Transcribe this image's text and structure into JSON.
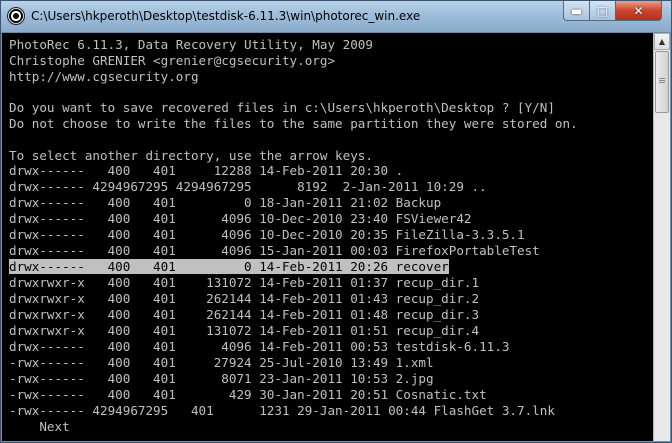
{
  "window": {
    "title": "C:\\Users\\hkperoth\\Desktop\\testdisk-6.11.3\\win\\photorec_win.exe",
    "controls": {
      "minimize": "▬",
      "maximize": "□",
      "close": "✕"
    }
  },
  "console": {
    "header": [
      "PhotoRec 6.11.3, Data Recovery Utility, May 2009",
      "Christophe GRENIER <grenier@cgsecurity.org>",
      "http://www.cgsecurity.org"
    ],
    "question": [
      "Do you want to save recovered files in c:\\Users\\hkperoth\\Desktop ? [Y/N]",
      "Do not choose to write the files to the same partition they were stored on."
    ],
    "hint": "To select another directory, use the arrow keys.",
    "entries": [
      "drwx------   400   401     12288 14-Feb-2011 20:30 .",
      "drwx------ 4294967295 4294967295      8192  2-Jan-2011 10:29 ..",
      "drwx------   400   401         0 18-Jan-2011 21:02 Backup",
      "drwx------   400   401      4096 10-Dec-2010 23:40 FSViewer42",
      "drwx------   400   401      4096 10-Dec-2010 20:35 FileZilla-3.3.5.1",
      "drwx------   400   401      4096 15-Jan-2011 00:03 FirefoxPortableTest",
      "drwx------   400   401         0 14-Feb-2011 20:26 recover",
      "drwxrwxr-x   400   401    131072 14-Feb-2011 01:37 recup_dir.1",
      "drwxrwxr-x   400   401    262144 14-Feb-2011 01:43 recup_dir.2",
      "drwxrwxr-x   400   401    262144 14-Feb-2011 01:48 recup_dir.3",
      "drwxrwxr-x   400   401    131072 14-Feb-2011 01:51 recup_dir.4",
      "drwx------   400   401      4096 14-Feb-2011 00:53 testdisk-6.11.3",
      "-rwx------   400   401     27924 25-Jul-2010 13:49 1.xml",
      "-rwx------   400   401      8071 23-Jan-2011 10:53 2.jpg",
      "-rwx------   400   401       429 30-Jan-2011 20:51 Cosnatic.txt",
      "-rwx------ 4294967295   401      1231 29-Jan-2011 00:44 FlashGet 3.7.lnk"
    ],
    "selected_index": 6,
    "next_label": "    Next"
  }
}
